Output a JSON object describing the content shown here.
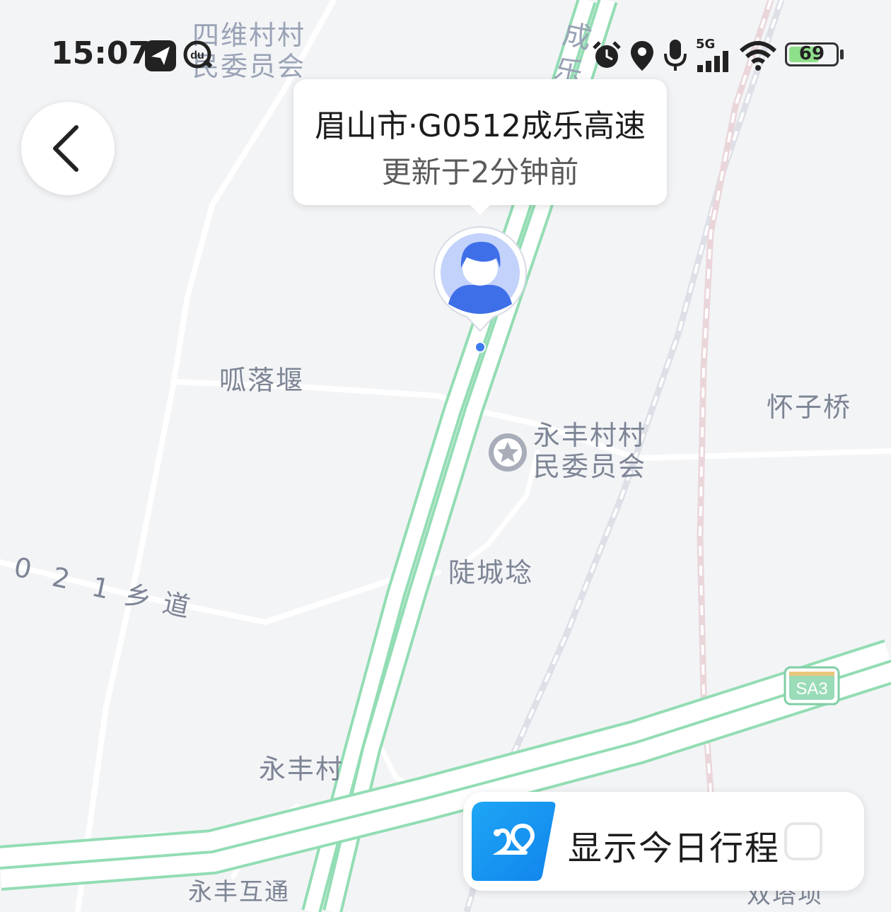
{
  "status_bar": {
    "time": "15:07",
    "network": "5G",
    "battery": 69,
    "icons": [
      "send-icon",
      "du-search-icon",
      "alarm-icon",
      "location-icon",
      "mic-icon",
      "signal-icon",
      "wifi-icon",
      "battery-icon"
    ]
  },
  "map": {
    "labels": {
      "siwei_1": "四维村村",
      "siwei_2": "民委员会",
      "chengle_1": "成",
      "chengle_2": "乐",
      "gualuoyan": "呱落堰",
      "huaiziqiao": "怀子桥",
      "yongfeng_cw_1": "永丰村村",
      "yongfeng_cw_2": "民委员会",
      "luchengshan": "陡城埝",
      "township_road": [
        "0",
        "2",
        "1",
        "乡",
        "道"
      ],
      "yongfengcun": "永丰村",
      "yongfeng_interchange": "永丰互通",
      "shuangta": "双塔坝",
      "shield": "SA3"
    },
    "colors": {
      "background": "#f3f4f6",
      "road": "#ffffff",
      "expressway_edge": "#93ddb4",
      "user_dot": "#3b7cf0"
    }
  },
  "location_bubble": {
    "title": "眉山市·G0512成乐高速",
    "subtitle": "更新于2分钟前"
  },
  "back_button": {
    "icon": "chevron-left-icon"
  },
  "itinerary": {
    "label": "显示今日行程",
    "checked": false,
    "icon": "route-icon"
  }
}
